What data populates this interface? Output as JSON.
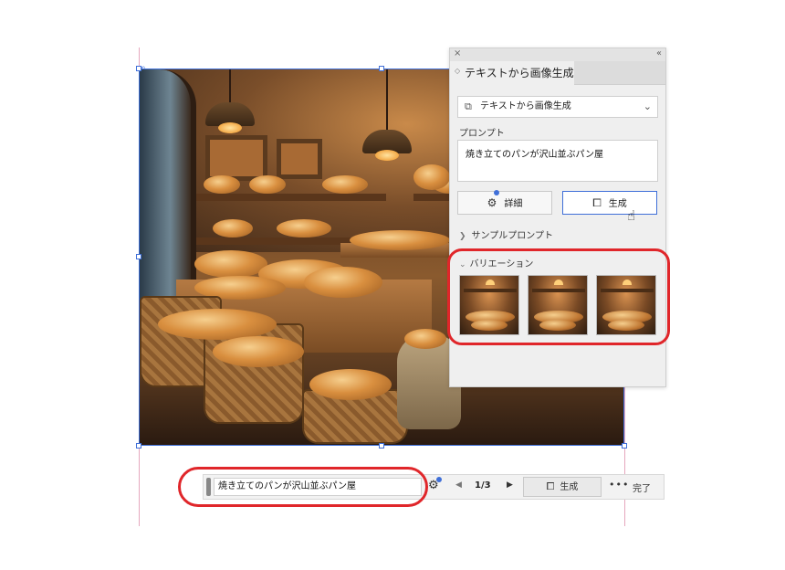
{
  "panel": {
    "close_icon": "×",
    "collapse_icon": "‹‹",
    "tab_label": "テキストから画像生成",
    "mode_select": {
      "value": "テキストから画像生成",
      "icon": "text-to-image-icon"
    },
    "prompt_label": "プロンプト",
    "prompt_value": "焼き立てのパンが沢山並ぶパン屋",
    "detail_button": "詳細",
    "generate_button": "生成",
    "sample_prompt_label": "サンプルプロンプト",
    "variations_label": "バリエーション",
    "variation_count": 3
  },
  "context_bar": {
    "prompt_value": "焼き立てのパンが沢山並ぶパン屋",
    "page_indicator": "1/3",
    "generate_button": "生成",
    "more_label": "•••",
    "done_button": "完了"
  },
  "colors": {
    "selection_blue": "#3f6fd8",
    "highlight_red": "#e0262a",
    "guide_pink": "#e6a7bd"
  }
}
